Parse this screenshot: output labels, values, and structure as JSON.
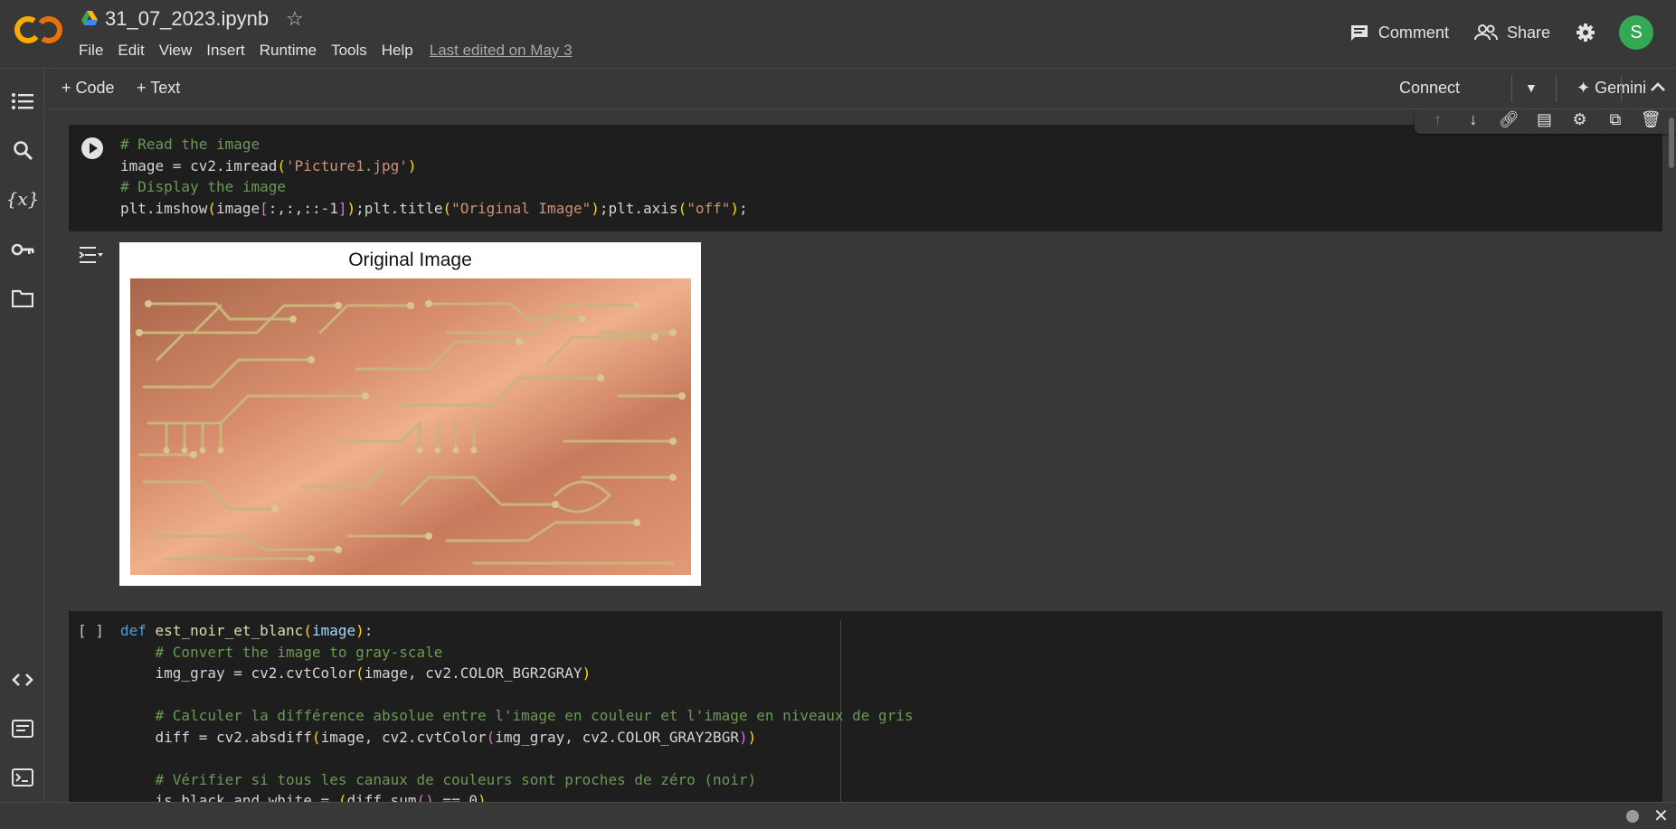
{
  "header": {
    "logo": "CO",
    "file_name": "31_07_2023.ipynb",
    "menu": [
      "File",
      "Edit",
      "View",
      "Insert",
      "Runtime",
      "Tools",
      "Help"
    ],
    "last_edited": "Last edited on May 3",
    "comment_label": "Comment",
    "share_label": "Share",
    "avatar_letter": "S"
  },
  "toolbar": {
    "add_code": "+ Code",
    "add_text": "+ Text",
    "connect": "Connect",
    "gemini": "Gemini"
  },
  "cells": [
    {
      "type": "code",
      "lines": [
        "# Read the image",
        "image = cv2.imread('Picture1.jpg')",
        "# Display the image",
        "plt.imshow(image[:,:,::-1]);plt.title(\"Original Image\");plt.axis(\"off\");"
      ],
      "output_title": "Original Image"
    },
    {
      "type": "code",
      "execution_count": "[ ]",
      "lines": [
        "def est_noir_et_blanc(image):",
        "    # Convert the image to gray-scale",
        "    img_gray = cv2.cvtColor(image, cv2.COLOR_BGR2GRAY)",
        "",
        "    # Calculer la différence absolue entre l'image en couleur et l'image en niveaux de gris",
        "    diff = cv2.absdiff(image, cv2.cvtColor(img_gray, cv2.COLOR_GRAY2BGR))",
        "",
        "    # Vérifier si tous les canaux de couleurs sont proches de zéro (noir)",
        "    is_black_and_white = (diff.sum() == 0)"
      ]
    }
  ],
  "colors": {
    "background": "#383838",
    "cell_background": "#1e1e1e",
    "comment": "#6a9955",
    "string": "#ce9178",
    "avatar": "#34a853"
  }
}
